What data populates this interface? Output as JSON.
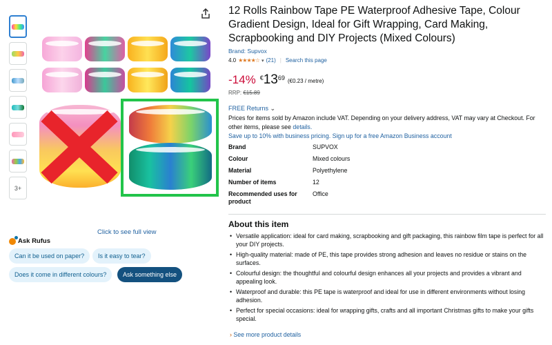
{
  "product": {
    "title": "12 Rolls Rainbow Tape PE Waterproof Adhesive Tape, Colour Gradient Design, Ideal for Gift Wrapping, Card Making, Scrapbooking and DIY Projects (Mixed Colours)",
    "brand_link": "Brand: Supvox",
    "rating_value": "4.0",
    "stars": "★★★★☆",
    "review_count": "(21)",
    "search_page": "Search this page"
  },
  "price": {
    "discount": "-14%",
    "currency": "€",
    "whole": "13",
    "fraction": "69",
    "unit_price": "(€0.23 / metre)",
    "rrp_label": "RRP:",
    "rrp_value": "€15.89"
  },
  "delivery": {
    "free_returns": "FREE Returns",
    "vat_text": "Prices for items sold by Amazon include VAT. Depending on your delivery address, VAT may vary at Checkout. For other items, please see",
    "details_link": "details.",
    "business_link": "Save up to 10% with business pricing. Sign up for a free Amazon Business account"
  },
  "specs": [
    {
      "key": "Brand",
      "value": "SUPVOX"
    },
    {
      "key": "Colour",
      "value": "Mixed colours"
    },
    {
      "key": "Material",
      "value": "Polyethylene"
    },
    {
      "key": "Number of items",
      "value": "12"
    },
    {
      "key": "Recommended uses for product",
      "value": "Office"
    }
  ],
  "about": {
    "heading": "About this item",
    "bullets": [
      "Versatile application: ideal for card making, scrapbooking and gift packaging, this rainbow film tape is perfect for all your DIY projects.",
      "High-quality material: made of PE, this tape provides strong adhesion and leaves no residue or stains on the surfaces.",
      "Colourful design: the thoughtful and colourful design enhances all your projects and provides a vibrant and appealing look.",
      "Waterproof and durable: this PE tape is waterproof and ideal for use in different environments without losing adhesion.",
      "Perfect for special occasions: ideal for wrapping gifts, crafts and all important Christmas gifts to make your gifts special."
    ],
    "see_more": "See more product details"
  },
  "gallery": {
    "click_view": "Click to see full view",
    "more_thumbs": "3+"
  },
  "rufus": {
    "label": "Ask Rufus",
    "questions": [
      "Can it be used on paper?",
      "Is it easy to tear?",
      "Does it come in different colours?"
    ],
    "ask_button": "Ask something else"
  },
  "colors": {
    "link": "#2162a1",
    "discount": "#cc0c39",
    "star": "#de7921",
    "highlight_box": "#22c44a",
    "cross": "#e8242b"
  }
}
